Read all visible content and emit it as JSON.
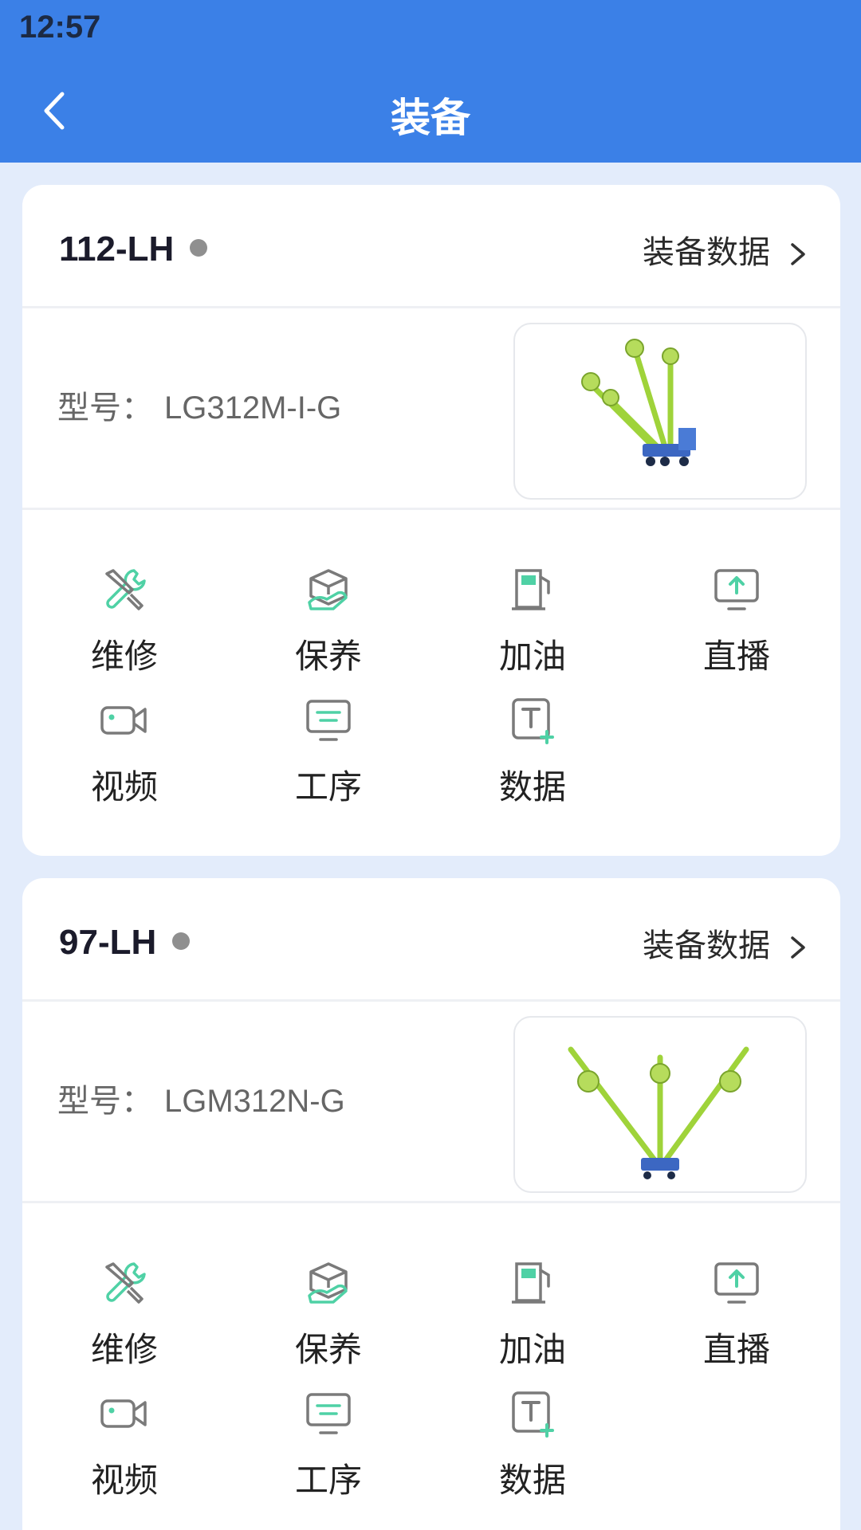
{
  "status_bar": {
    "time": "12:57"
  },
  "header": {
    "title": "装备"
  },
  "cards": [
    {
      "name": "112-LH",
      "data_link": "装备数据",
      "model_label": "型号：",
      "model": "LG312M-I-G",
      "actions": [
        "维修",
        "保养",
        "加油",
        "直播",
        "视频",
        "工序",
        "数据"
      ]
    },
    {
      "name": "97-LH",
      "data_link": "装备数据",
      "model_label": "型号：",
      "model": "LGM312N-G",
      "actions": [
        "维修",
        "保养",
        "加油",
        "直播",
        "视频",
        "工序",
        "数据"
      ]
    }
  ],
  "colors": {
    "header": "#3b80e7",
    "accent": "#4fd1a5",
    "icon_gray": "#7a7a7a",
    "status_dot": "#8f8f8f"
  }
}
